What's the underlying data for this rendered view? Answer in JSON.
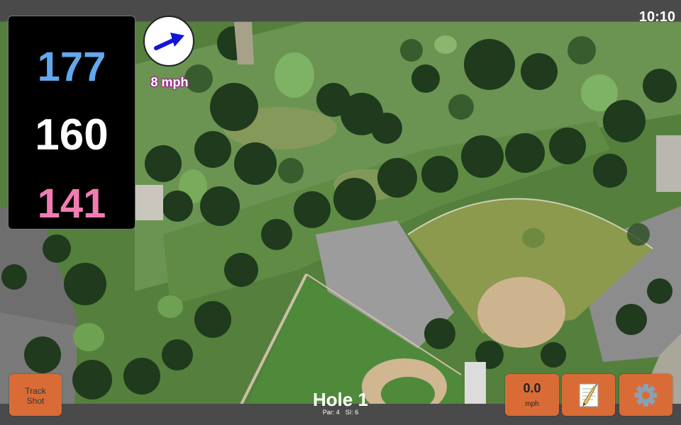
{
  "status": {
    "time": "10:10"
  },
  "yardage": {
    "back": "177",
    "middle": "160",
    "front": "141"
  },
  "wind": {
    "speed_text": "8 mph",
    "direction_icon": "arrow-right-icon"
  },
  "hole": {
    "title": "Hole 1",
    "par": "Par: 4",
    "si": "SI: 6"
  },
  "buttons": {
    "track_shot_line1": "Track",
    "track_shot_line2": "Shot",
    "speed_value": "0.0",
    "speed_unit": "mph",
    "notes_icon": "notepad-icon",
    "settings_icon": "gear-icon"
  },
  "colors": {
    "back_yardage": "#62a8ee",
    "middle_yardage": "#ffffff",
    "front_yardage": "#f27cb2",
    "button": "#d96c36",
    "wind_text_outline": "#a0278f"
  }
}
